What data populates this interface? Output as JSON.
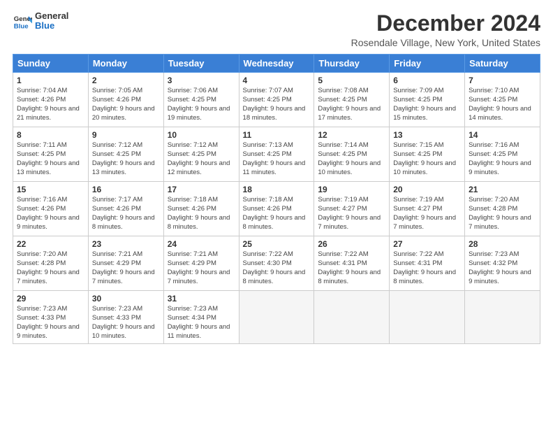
{
  "header": {
    "logo_line1": "General",
    "logo_line2": "Blue",
    "month_title": "December 2024",
    "location": "Rosendale Village, New York, United States"
  },
  "days_of_week": [
    "Sunday",
    "Monday",
    "Tuesday",
    "Wednesday",
    "Thursday",
    "Friday",
    "Saturday"
  ],
  "weeks": [
    [
      {
        "num": "1",
        "sunrise": "7:04 AM",
        "sunset": "4:26 PM",
        "daylight": "9 hours and 21 minutes."
      },
      {
        "num": "2",
        "sunrise": "7:05 AM",
        "sunset": "4:26 PM",
        "daylight": "9 hours and 20 minutes."
      },
      {
        "num": "3",
        "sunrise": "7:06 AM",
        "sunset": "4:25 PM",
        "daylight": "9 hours and 19 minutes."
      },
      {
        "num": "4",
        "sunrise": "7:07 AM",
        "sunset": "4:25 PM",
        "daylight": "9 hours and 18 minutes."
      },
      {
        "num": "5",
        "sunrise": "7:08 AM",
        "sunset": "4:25 PM",
        "daylight": "9 hours and 17 minutes."
      },
      {
        "num": "6",
        "sunrise": "7:09 AM",
        "sunset": "4:25 PM",
        "daylight": "9 hours and 15 minutes."
      },
      {
        "num": "7",
        "sunrise": "7:10 AM",
        "sunset": "4:25 PM",
        "daylight": "9 hours and 14 minutes."
      }
    ],
    [
      {
        "num": "8",
        "sunrise": "7:11 AM",
        "sunset": "4:25 PM",
        "daylight": "9 hours and 13 minutes."
      },
      {
        "num": "9",
        "sunrise": "7:12 AM",
        "sunset": "4:25 PM",
        "daylight": "9 hours and 13 minutes."
      },
      {
        "num": "10",
        "sunrise": "7:12 AM",
        "sunset": "4:25 PM",
        "daylight": "9 hours and 12 minutes."
      },
      {
        "num": "11",
        "sunrise": "7:13 AM",
        "sunset": "4:25 PM",
        "daylight": "9 hours and 11 minutes."
      },
      {
        "num": "12",
        "sunrise": "7:14 AM",
        "sunset": "4:25 PM",
        "daylight": "9 hours and 10 minutes."
      },
      {
        "num": "13",
        "sunrise": "7:15 AM",
        "sunset": "4:25 PM",
        "daylight": "9 hours and 10 minutes."
      },
      {
        "num": "14",
        "sunrise": "7:16 AM",
        "sunset": "4:25 PM",
        "daylight": "9 hours and 9 minutes."
      }
    ],
    [
      {
        "num": "15",
        "sunrise": "7:16 AM",
        "sunset": "4:26 PM",
        "daylight": "9 hours and 9 minutes."
      },
      {
        "num": "16",
        "sunrise": "7:17 AM",
        "sunset": "4:26 PM",
        "daylight": "9 hours and 8 minutes."
      },
      {
        "num": "17",
        "sunrise": "7:18 AM",
        "sunset": "4:26 PM",
        "daylight": "9 hours and 8 minutes."
      },
      {
        "num": "18",
        "sunrise": "7:18 AM",
        "sunset": "4:26 PM",
        "daylight": "9 hours and 8 minutes."
      },
      {
        "num": "19",
        "sunrise": "7:19 AM",
        "sunset": "4:27 PM",
        "daylight": "9 hours and 7 minutes."
      },
      {
        "num": "20",
        "sunrise": "7:19 AM",
        "sunset": "4:27 PM",
        "daylight": "9 hours and 7 minutes."
      },
      {
        "num": "21",
        "sunrise": "7:20 AM",
        "sunset": "4:28 PM",
        "daylight": "9 hours and 7 minutes."
      }
    ],
    [
      {
        "num": "22",
        "sunrise": "7:20 AM",
        "sunset": "4:28 PM",
        "daylight": "9 hours and 7 minutes."
      },
      {
        "num": "23",
        "sunrise": "7:21 AM",
        "sunset": "4:29 PM",
        "daylight": "9 hours and 7 minutes."
      },
      {
        "num": "24",
        "sunrise": "7:21 AM",
        "sunset": "4:29 PM",
        "daylight": "9 hours and 7 minutes."
      },
      {
        "num": "25",
        "sunrise": "7:22 AM",
        "sunset": "4:30 PM",
        "daylight": "9 hours and 8 minutes."
      },
      {
        "num": "26",
        "sunrise": "7:22 AM",
        "sunset": "4:31 PM",
        "daylight": "9 hours and 8 minutes."
      },
      {
        "num": "27",
        "sunrise": "7:22 AM",
        "sunset": "4:31 PM",
        "daylight": "9 hours and 8 minutes."
      },
      {
        "num": "28",
        "sunrise": "7:23 AM",
        "sunset": "4:32 PM",
        "daylight": "9 hours and 9 minutes."
      }
    ],
    [
      {
        "num": "29",
        "sunrise": "7:23 AM",
        "sunset": "4:33 PM",
        "daylight": "9 hours and 9 minutes."
      },
      {
        "num": "30",
        "sunrise": "7:23 AM",
        "sunset": "4:33 PM",
        "daylight": "9 hours and 10 minutes."
      },
      {
        "num": "31",
        "sunrise": "7:23 AM",
        "sunset": "4:34 PM",
        "daylight": "9 hours and 11 minutes."
      },
      null,
      null,
      null,
      null
    ]
  ],
  "labels": {
    "sunrise": "Sunrise:",
    "sunset": "Sunset:",
    "daylight": "Daylight:"
  }
}
